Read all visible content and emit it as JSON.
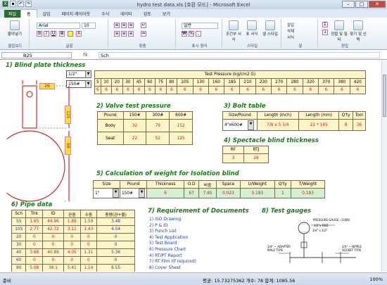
{
  "window": {
    "title": "hydro test data.xls [호환 모드] - Microsoft Excel"
  },
  "tabs": [
    "파일",
    "홈",
    "삽입",
    "페이지 레이아웃",
    "수식",
    "데이터",
    "검토",
    "보기"
  ],
  "ribbon": {
    "paste": "붙여넣기",
    "clipboard": "클립보드",
    "font_name": "Arial",
    "font_size": "10",
    "font_group": "글꼴",
    "align_group": "맞춤",
    "num_format": "일반",
    "num_group": "표시 형식",
    "style_btn1": "조건부 서식",
    "style_btn2": "표 서식",
    "style_btn3": "셀 스타일",
    "style_group": "스타일",
    "insert": "삽입",
    "delete": "삭제",
    "format": "서식",
    "cells_group": "셀",
    "sort": "정렬 및 필터",
    "find": "찾기 및 선택",
    "edit_group": "편집"
  },
  "formula": {
    "cell": "B25",
    "fx": "fx",
    "content": "Sch"
  },
  "status": {
    "ready": "준비",
    "stats": "평균: 15.73275362   개수: 78   합계: 1085.56",
    "zoom": "100%"
  },
  "sections": {
    "s1": "1) Blind plate thickness",
    "s2": "2) Valve test pressure",
    "s3": "3) Bolt table",
    "s4": "4) Spectacle blind thickness",
    "s5": "5) Calculation of weight for Isolation blind",
    "s6": "6) Pipe data",
    "s7": "7) Requirement of Documents",
    "s8": "8) Test gauges"
  },
  "blind": {
    "size": "1/2\"",
    "rating": "150#",
    "header": "Test Pressure (kg/cm2 G)",
    "pressures": [
      "5",
      "10",
      "20",
      "30",
      "45",
      "60",
      "75",
      "80",
      "105",
      "130",
      "160",
      "185",
      "210",
      "230",
      "270",
      "280",
      "320",
      "370",
      "380",
      "420"
    ],
    "values": [
      "6",
      "6",
      "6",
      "6",
      "6",
      "6",
      "6",
      "6",
      "6",
      "6",
      "6",
      "6",
      "6",
      "6",
      "6",
      "6",
      "6",
      "6",
      "6",
      "6"
    ],
    "dim_top": "26",
    "dim_mid": "125",
    "dim_bot": "98"
  },
  "valve": {
    "headers": [
      "Pound",
      "150#",
      "300#",
      "600#"
    ],
    "rows": [
      [
        "Body",
        "32",
        "79",
        "152"
      ],
      [
        "Seat",
        "22",
        "52",
        "125"
      ]
    ]
  },
  "bolt": {
    "headers": [
      "Size/Pound",
      "Length (Inch)",
      "Length (mm)",
      "Q'ty",
      "Tool"
    ],
    "row": [
      "4\"x600#",
      "7/8 x 5 3/4",
      "22  *  145",
      "8",
      "36"
    ]
  },
  "spectacle": {
    "headers": [
      "RF",
      "RTJ"
    ],
    "row": [
      "3",
      "19"
    ]
  },
  "calc": {
    "headers": [
      "Size",
      "Pound",
      "Thickness",
      "O.D",
      "비중",
      "Space",
      "U/Weight",
      "Q'ty",
      "T/Weight"
    ],
    "row": [
      "1\"",
      "150#",
      "6",
      "67",
      "7.85",
      "0.023",
      "0.183",
      "1",
      "0.183"
    ]
  },
  "pipe": {
    "headers": [
      "Sch",
      "Thk",
      "ID",
      "관중",
      "수중",
      "총량(관+물)"
    ],
    "rows": [
      [
        "5S",
        "1.65",
        "44.96",
        "1.89",
        "1.59",
        "3.48"
      ],
      [
        "10S",
        "2.77",
        "42.72",
        "3.11",
        "1.43",
        "4.54"
      ],
      [
        "20",
        "0",
        "0",
        "0",
        "0",
        "0"
      ],
      [
        "30",
        "0",
        "0",
        "0",
        "0",
        "0"
      ],
      [
        "40",
        "3.68",
        "40.89",
        "4.05",
        "1.31",
        "5.36"
      ],
      [
        "60",
        "0",
        "0",
        "0",
        "0",
        "0"
      ],
      [
        "80",
        "5.08",
        "38.1",
        "5.41",
        "1.14",
        "6.55"
      ],
      [
        "100",
        "0",
        "0",
        "0",
        "0",
        "0"
      ]
    ]
  },
  "docs": [
    "1) ISO Drawing",
    "2) P & ID",
    "3) Punch List",
    "4) Test Application",
    "5) Test Board",
    "6) Pressure Chart",
    "4) RT/PT Report",
    "7) RT Film (if required)",
    "8) Cover Sheet"
  ],
  "gauges": {
    "lbl1": "PRESSURE GAUGE, (100K)",
    "lbl2": "1/2\"x RED.",
    "lbl3": "3/4\" x 1/2\"",
    "lbl4": "3/4\" ~ ADAPTER",
    "lbl5": "MALE TYPE",
    "lbl6": "3/4\" ~ NIPPLE",
    "lbl7": "SOCKET TYPE"
  },
  "colors": {
    "section": "#1a7a1a",
    "table_fill": "#fff5c9",
    "value_red": "#c0161b",
    "value_blue": "#1b3fa0"
  }
}
